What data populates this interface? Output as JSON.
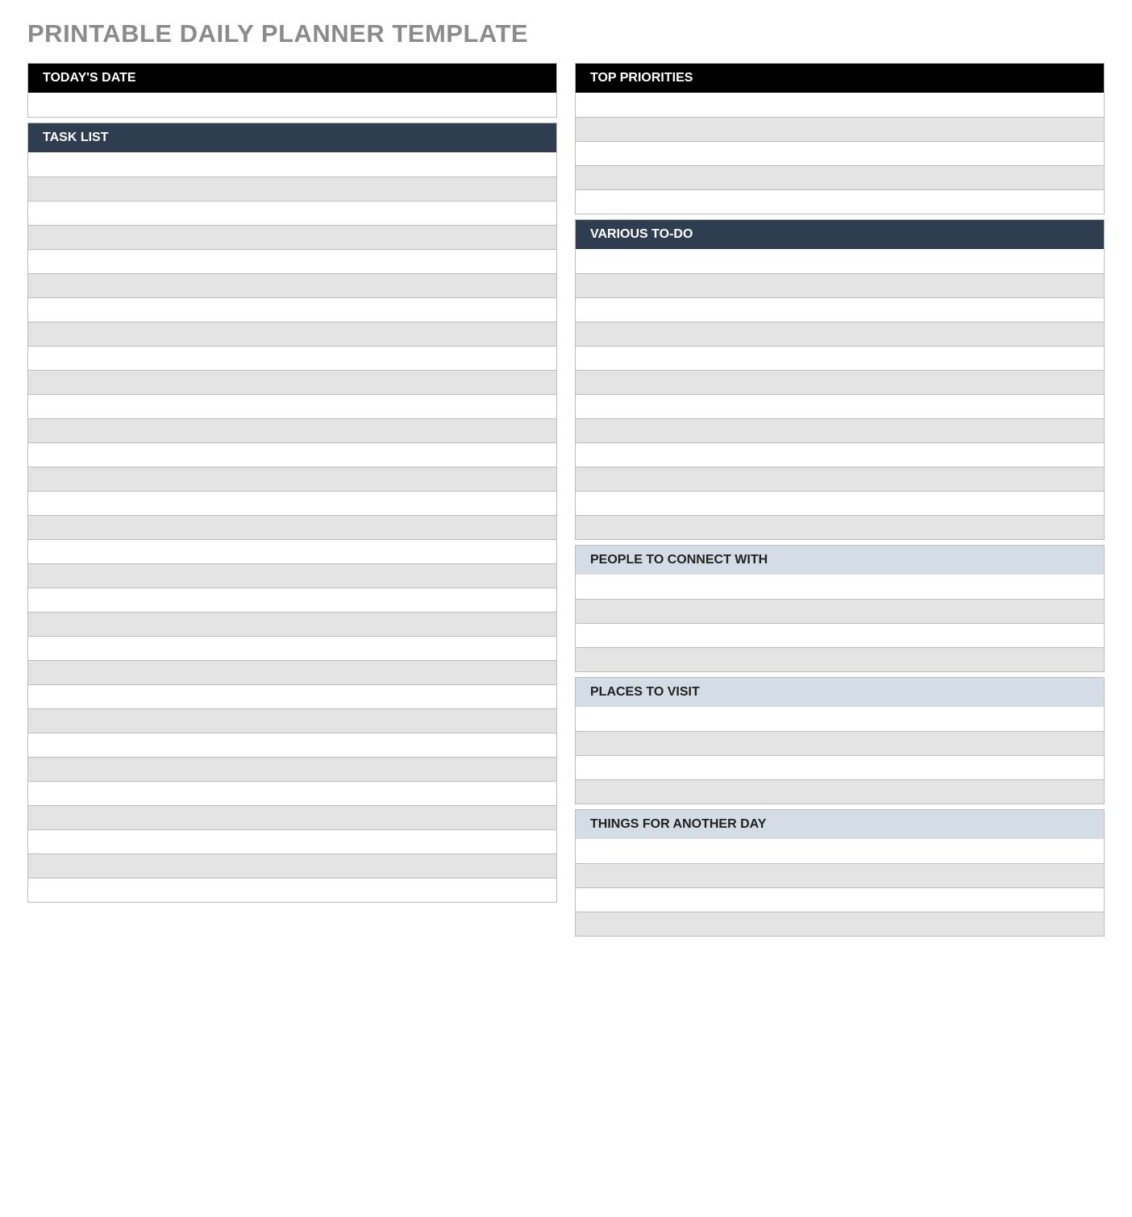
{
  "title": "PRINTABLE DAILY PLANNER TEMPLATE",
  "left": {
    "date": {
      "label": "TODAY'S DATE",
      "rows": [
        ""
      ]
    },
    "tasks": {
      "label": "TASK LIST",
      "rows": [
        "",
        "",
        "",
        "",
        "",
        "",
        "",
        "",
        "",
        "",
        "",
        "",
        "",
        "",
        "",
        "",
        "",
        "",
        "",
        "",
        "",
        "",
        "",
        "",
        "",
        "",
        "",
        "",
        "",
        "",
        ""
      ]
    }
  },
  "right": {
    "priorities": {
      "label": "TOP PRIORITIES",
      "rows": [
        "",
        "",
        "",
        "",
        ""
      ]
    },
    "todo": {
      "label": "VARIOUS TO-DO",
      "rows": [
        "",
        "",
        "",
        "",
        "",
        "",
        "",
        "",
        "",
        "",
        "",
        ""
      ]
    },
    "people": {
      "label": "PEOPLE TO CONNECT WITH",
      "rows": [
        "",
        "",
        "",
        ""
      ]
    },
    "places": {
      "label": "PLACES TO VISIT",
      "rows": [
        "",
        "",
        "",
        ""
      ]
    },
    "later": {
      "label": "THINGS FOR ANOTHER DAY",
      "rows": [
        "",
        "",
        "",
        ""
      ]
    }
  }
}
